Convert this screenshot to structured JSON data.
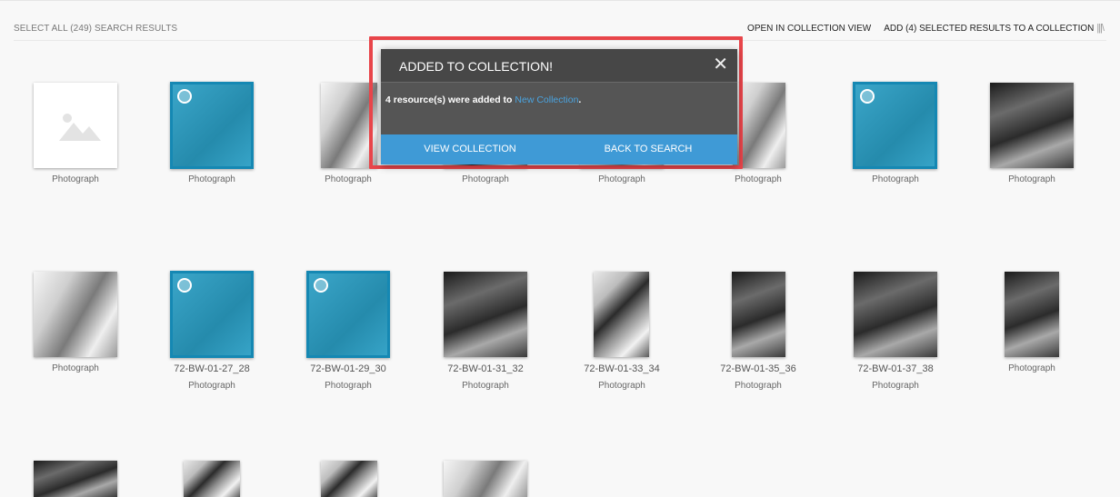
{
  "header": {
    "select_all": "SELECT ALL (249) SEARCH RESULTS",
    "open_collection": "OPEN IN COLLECTION VIEW",
    "add_selected": "ADD (4) SELECTED RESULTS TO A COLLECTION"
  },
  "row1": [
    {
      "type": "Photograph"
    },
    {
      "type": "Photograph"
    },
    {
      "type": "Photograph"
    },
    {
      "type": "Photograph"
    },
    {
      "type": "Photograph"
    },
    {
      "type": "Photograph"
    },
    {
      "type": "Photograph"
    },
    {
      "type": "Photograph"
    }
  ],
  "row2": [
    {
      "title": "",
      "type": "Photograph"
    },
    {
      "title": "72-BW-01-27_28",
      "type": "Photograph"
    },
    {
      "title": "72-BW-01-29_30",
      "type": "Photograph"
    },
    {
      "title": "72-BW-01-31_32",
      "type": "Photograph"
    },
    {
      "title": "72-BW-01-33_34",
      "type": "Photograph"
    },
    {
      "title": "72-BW-01-35_36",
      "type": "Photograph"
    },
    {
      "title": "72-BW-01-37_38",
      "type": "Photograph"
    },
    {
      "title": "",
      "type": "Photograph"
    }
  ],
  "modal": {
    "title": "ADDED TO COLLECTION!",
    "close_glyph": "✕",
    "message_prefix": "4 resource(s) were added to ",
    "collection_link": "New Collection",
    "message_suffix": ".",
    "view_button": "VIEW COLLECTION",
    "back_button": "BACK TO SEARCH"
  },
  "colors": {
    "selected": "#2a9ec4",
    "button": "#3f9ad6",
    "highlight": "#e8454a"
  }
}
